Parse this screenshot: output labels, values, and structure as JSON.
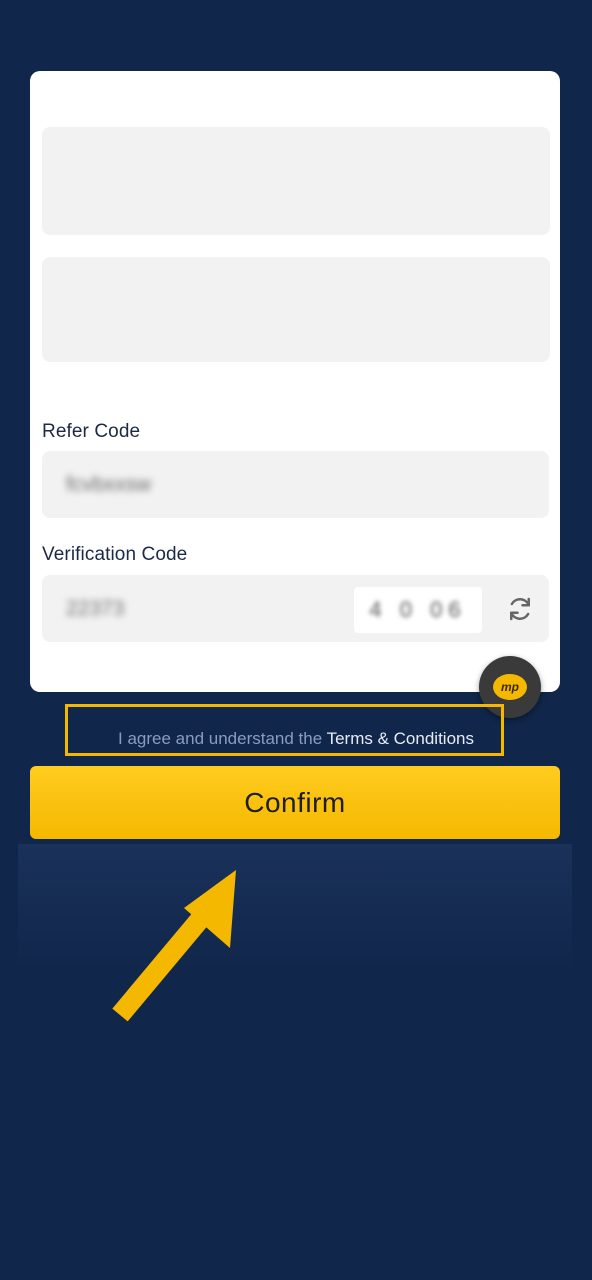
{
  "colors": {
    "background": "#10264a",
    "accent": "#f5b800",
    "card": "#ffffff",
    "field": "#f2f2f2",
    "link": "#e8ecf5"
  },
  "form": {
    "refer_label": "Refer Code",
    "refer_value": "fcvbxxsw",
    "verify_label": "Verification Code",
    "verify_value": "22373",
    "captcha_text": "4 0 06",
    "refresh_icon": "refresh-icon"
  },
  "chat": {
    "label": "mp",
    "icon": "chat-bubble-icon"
  },
  "terms": {
    "prefix": "I agree and understand the ",
    "link": "Terms & Conditions"
  },
  "confirm_label": "Confirm",
  "annotation": {
    "arrow_icon": "arrow-up-right-icon"
  }
}
